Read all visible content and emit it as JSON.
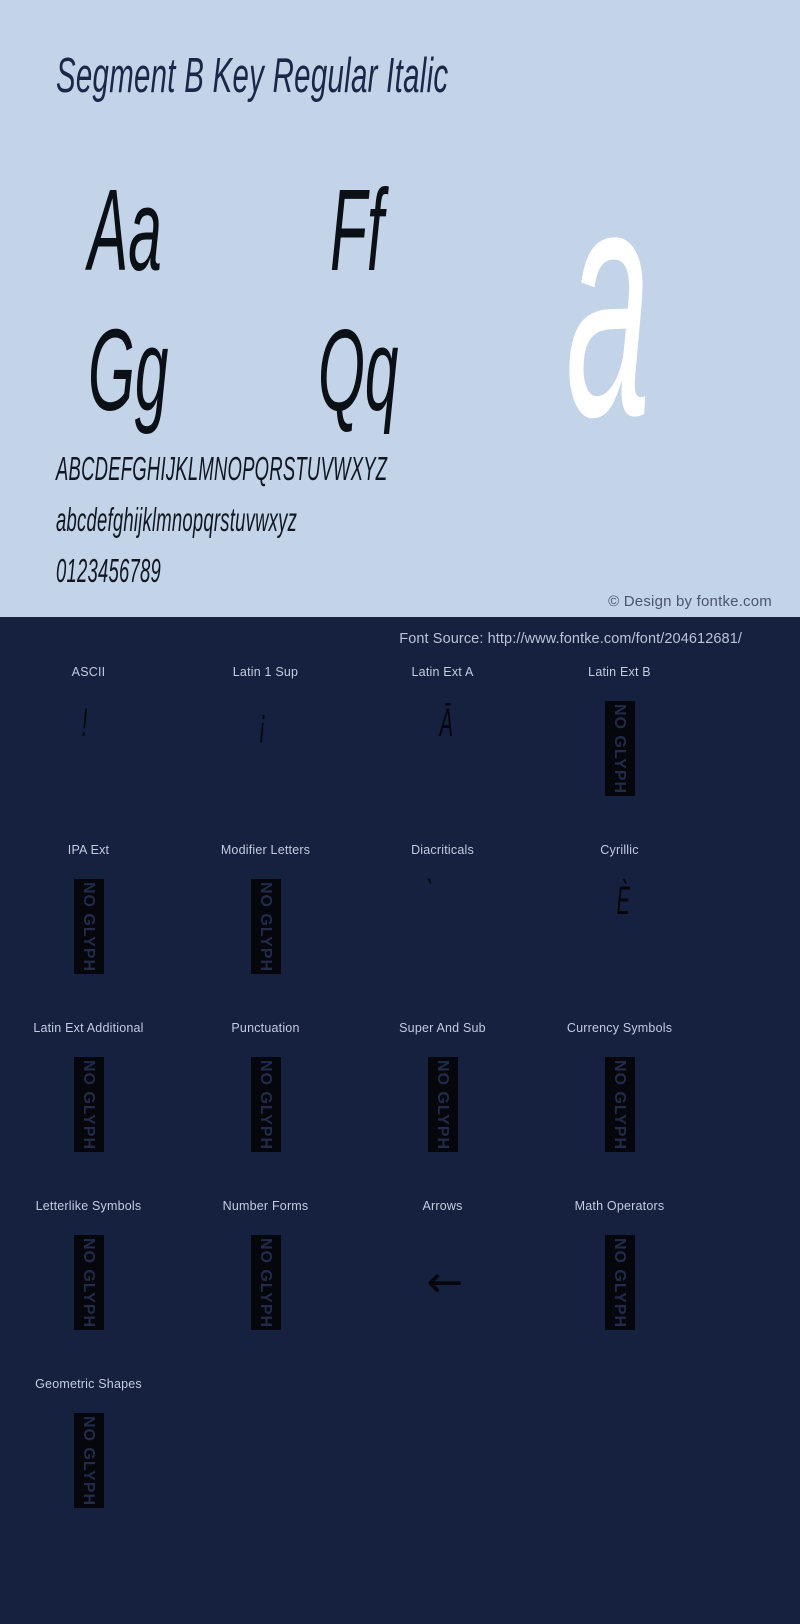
{
  "specimen": {
    "title": "Segment B Key Regular Italic",
    "glyph_pairs": [
      "Aa",
      "Ff",
      "Gg",
      "Qq"
    ],
    "feature_glyph": "a",
    "alphabet_uppercase": "ABCDEFGHIJKLMNOPQRSTUVWXYZ",
    "alphabet_lowercase": "abcdefghijklmnopqrstuvwxyz",
    "digits": "0123456789",
    "design_credit": "© Design by fontke.com",
    "colors": {
      "panel_background": "#c3d4e9",
      "title_color": "#1b2748",
      "feature_glyph_color": "#ffffff",
      "dark_background": "#16203f"
    }
  },
  "source": {
    "label": "Font Source: http://www.fontke.com/font/204612681/"
  },
  "no_glyph_label": "NO GLYPH",
  "blocks": [
    [
      {
        "label": "ASCII",
        "sample": "!",
        "has_glyph": true,
        "style": "tiny"
      },
      {
        "label": "Latin 1 Sup",
        "sample": "¡",
        "has_glyph": true,
        "style": "tiny"
      },
      {
        "label": "Latin Ext A",
        "sample": "Ā",
        "has_glyph": true,
        "style": "tiny"
      },
      {
        "label": "Latin Ext B",
        "sample": "",
        "has_glyph": false,
        "style": ""
      }
    ],
    [
      {
        "label": "IPA Ext",
        "sample": "",
        "has_glyph": false,
        "style": ""
      },
      {
        "label": "Modifier Letters",
        "sample": "",
        "has_glyph": false,
        "style": ""
      },
      {
        "label": "Diacriticals",
        "sample": "̀",
        "has_glyph": true,
        "style": "tiny"
      },
      {
        "label": "Cyrillic",
        "sample": "È",
        "has_glyph": true,
        "style": "tiny"
      }
    ],
    [
      {
        "label": "Latin Ext Additional",
        "sample": "",
        "has_glyph": false,
        "style": ""
      },
      {
        "label": "Punctuation",
        "sample": "",
        "has_glyph": false,
        "style": ""
      },
      {
        "label": "Super And Sub",
        "sample": "",
        "has_glyph": false,
        "style": ""
      },
      {
        "label": "Currency Symbols",
        "sample": "",
        "has_glyph": false,
        "style": ""
      }
    ],
    [
      {
        "label": "Letterlike Symbols",
        "sample": "",
        "has_glyph": false,
        "style": ""
      },
      {
        "label": "Number Forms",
        "sample": "",
        "has_glyph": false,
        "style": ""
      },
      {
        "label": "Arrows",
        "sample": "←",
        "has_glyph": true,
        "style": "arrow"
      },
      {
        "label": "Math Operators",
        "sample": "",
        "has_glyph": false,
        "style": ""
      }
    ],
    [
      {
        "label": "Geometric Shapes",
        "sample": "",
        "has_glyph": false,
        "style": ""
      },
      {
        "label": "",
        "sample": "",
        "has_glyph": false,
        "style": "",
        "empty": true
      },
      {
        "label": "",
        "sample": "",
        "has_glyph": false,
        "style": "",
        "empty": true
      },
      {
        "label": "",
        "sample": "",
        "has_glyph": false,
        "style": "",
        "empty": true
      }
    ]
  ]
}
